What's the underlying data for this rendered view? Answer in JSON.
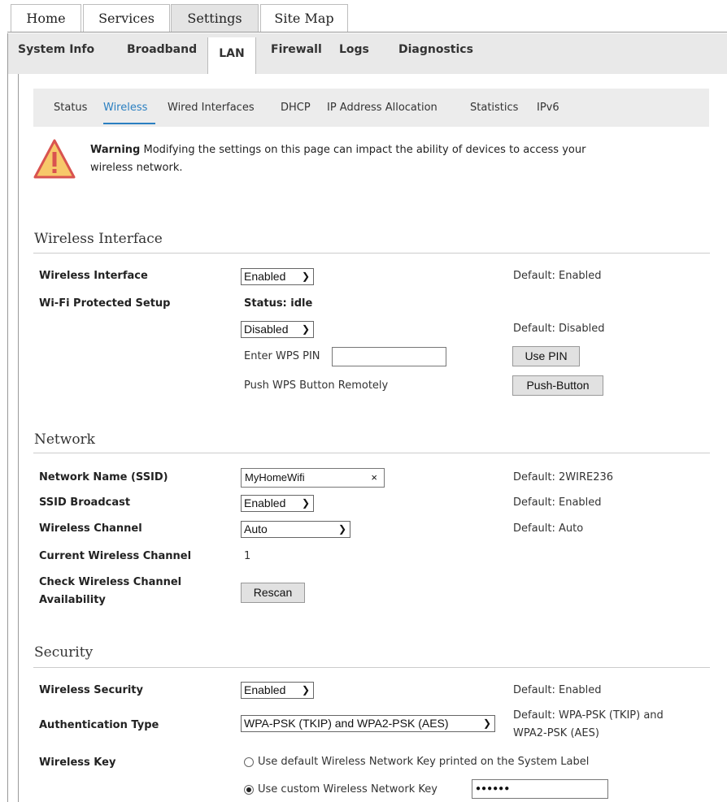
{
  "top_tabs": [
    "Home",
    "Services",
    "Settings",
    "Site Map"
  ],
  "sub_tabs": [
    "System Info",
    "Broadband",
    "LAN",
    "Firewall",
    "Logs",
    "Diagnostics"
  ],
  "lan_nav": [
    "Status",
    "Wireless",
    "Wired Interfaces",
    "DHCP",
    "IP Address Allocation",
    "Statistics",
    "IPv6"
  ],
  "warning": {
    "title": "Warning",
    "text": "Modifying the settings on this page can impact the ability of devices to access your",
    "text2": "wireless network."
  },
  "wireless_interface": {
    "section_title": "Wireless Interface",
    "interface_label": "Wireless Interface",
    "interface_value": "Enabled",
    "interface_default": "Default: Enabled",
    "wps_label": "Wi-Fi Protected Setup",
    "wps_status": "Status: idle",
    "wps_value": "Disabled",
    "wps_default": "Default: Disabled",
    "wps_pin_label": "Enter WPS PIN",
    "wps_pin_value": "",
    "use_pin_button": "Use PIN",
    "push_label": "Push WPS Button Remotely",
    "push_button": "Push-Button"
  },
  "network": {
    "section_title": "Network",
    "ssid_label": "Network Name (SSID)",
    "ssid_value": "MyHomeWifi",
    "ssid_clear": "×",
    "ssid_default": "Default: 2WIRE236",
    "broadcast_label": "SSID Broadcast",
    "broadcast_value": "Enabled",
    "broadcast_default": "Default: Enabled",
    "channel_label": "Wireless Channel",
    "channel_value": "Auto",
    "channel_default": "Default: Auto",
    "current_channel_label": "Current Wireless Channel",
    "current_channel_value": "1",
    "check_label_1": "Check Wireless Channel",
    "check_label_2": "Availability",
    "rescan_button": "Rescan"
  },
  "security": {
    "section_title": "Security",
    "wsec_label": "Wireless Security",
    "wsec_value": "Enabled",
    "wsec_default": "Default: Enabled",
    "auth_label": "Authentication Type",
    "auth_value": "WPA-PSK (TKIP) and WPA2-PSK (AES)",
    "auth_default_1": "Default: WPA-PSK (TKIP) and",
    "auth_default_2": "WPA2-PSK (AES)",
    "key_label": "Wireless Key",
    "key_option_default": "Use default Wireless Network Key printed on the System Label",
    "key_option_custom": "Use custom Wireless Network Key",
    "key_value": "●●●●●●"
  },
  "icons": {
    "warning": "warning-triangle-icon",
    "dropdown": "chevron-down-icon"
  },
  "colors": {
    "accent": "#2a7fc1",
    "warning_fill": "#f7c86a",
    "warning_stroke": "#d9534f"
  }
}
